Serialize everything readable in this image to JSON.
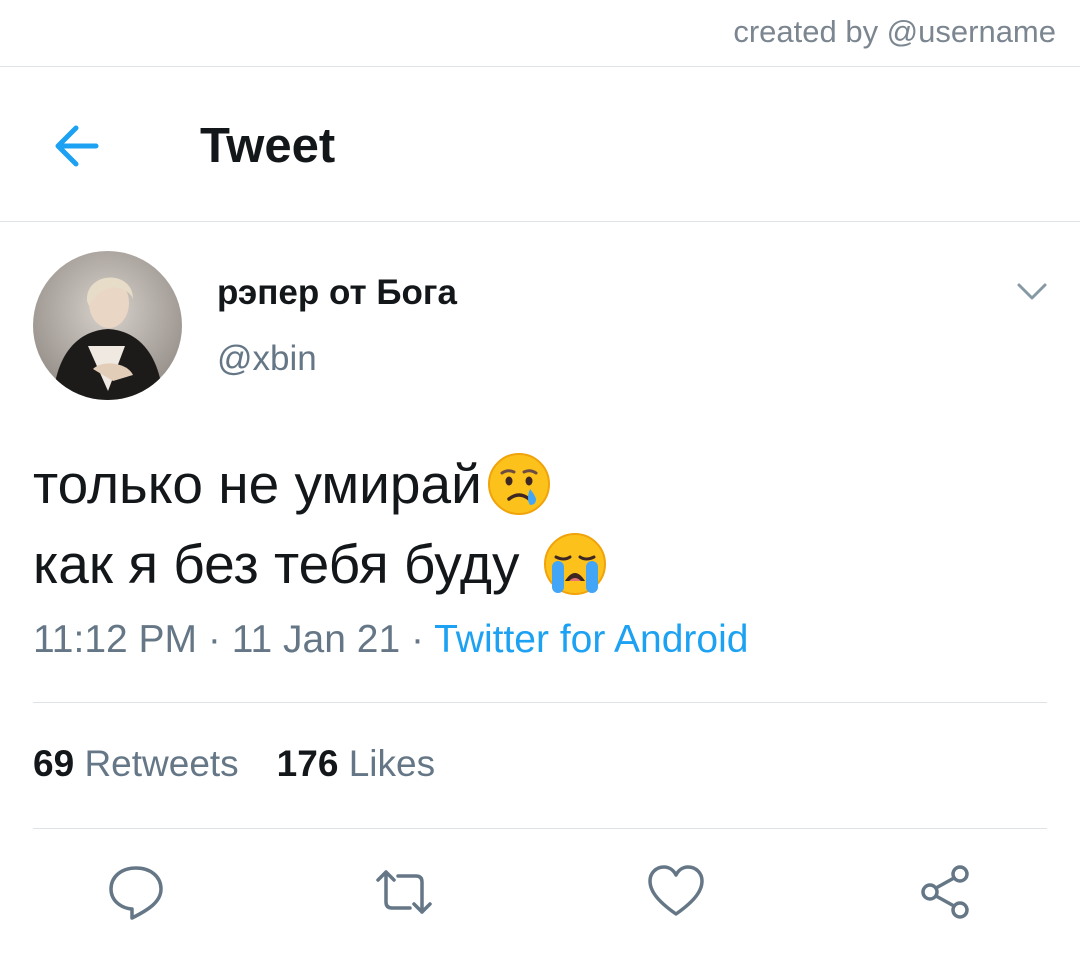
{
  "credit": "created by @username",
  "header": {
    "title": "Tweet"
  },
  "tweet": {
    "author_name": "рэпер от Бога",
    "handle": "@xbin",
    "text_lines": [
      "только не умирай",
      "как я без тебя буду"
    ],
    "time": "11:12 PM",
    "separator": "·",
    "date": "11 Jan 21",
    "source": "Twitter for Android",
    "retweets_count": "69",
    "retweets_label": "Retweets",
    "likes_count": "176",
    "likes_label": "Likes"
  },
  "icons": {
    "back": "arrow-left-icon",
    "more": "chevron-down-icon",
    "emoji_1": "crying-face-emoji",
    "emoji_2": "loudly-crying-face-emoji",
    "reply": "reply-icon",
    "retweet": "retweet-icon",
    "like": "heart-icon",
    "share": "share-icon"
  },
  "colors": {
    "accent": "#1da1f2",
    "text": "#14171a",
    "secondary": "#657786",
    "divider": "#dfe3e6"
  }
}
